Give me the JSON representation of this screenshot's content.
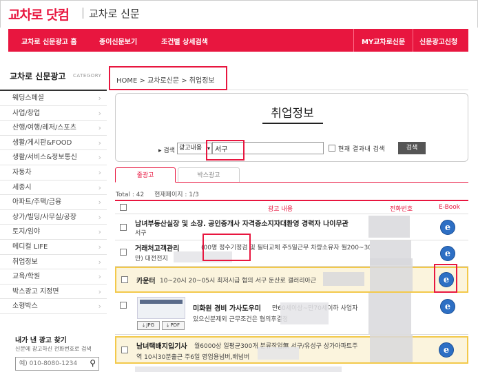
{
  "header": {
    "logo": "교차로 닷컴",
    "sub": "교차로 신문"
  },
  "nav": {
    "home": "교차로 신문광고 홈",
    "paper": "종이신문보기",
    "detail": "조건별 상세검색",
    "my": "MY교차로신문",
    "apply": "신문광고신청"
  },
  "sidebar": {
    "heading": "교차로 신문광고",
    "category": "CATEGORY",
    "items": [
      "웨딩스페셜",
      "사업/창업",
      "산행/여행/레저/스포츠",
      "생활/게시판&FOOD",
      "생활/서비스&정보통신",
      "자동차",
      "세종시",
      "아파트/주택/금융",
      "상가/빌딩/사무실/공장",
      "토지/임야",
      "메디컬 LIFE",
      "취업정보",
      "교육/학원",
      "박스광고 지정면",
      "소형박스"
    ]
  },
  "find": {
    "title": "내가 낸 광고 찾기",
    "desc": "신문에 광고하신 전화번호로 검색",
    "placeholder": "예) 010-8080-1234"
  },
  "breadcrumb": "HOME > 교차로신문 > 취업정보",
  "page_title": "취업정보",
  "search": {
    "label": "▸ 검색",
    "select_value": "광고내용",
    "input_value": "서구",
    "within_label": "현재 결과내 검색",
    "button": "검색"
  },
  "tabs": {
    "active": "줄광고",
    "inactive": "박스광고"
  },
  "totals": {
    "total": "Total : 42",
    "page": "현재페이지 : 1/3"
  },
  "table": {
    "col_content": "광고 내용",
    "col_phone": "전화번호",
    "col_ebook": "E-Book",
    "rows": [
      {
        "title": "남녀부동산실장 및 소장. 공인중개사 자격증소지자대환영 경력자 나이무관",
        "body": "서구"
      },
      {
        "title": "거래처고객관리",
        "body": "(00명 정수기정검 및 필터교체 주5일근무 차량소유자 월200~300",
        "body2": "만) 대전전지"
      },
      {
        "title": "카운터",
        "body": "10~20시 20~05시 최저시급 협의 서구 둔산로 갤러리아근"
      },
      {
        "title": "미화원 경비 가사도우미",
        "body": "만60세이상~만70세이하 사업자",
        "body2": "있으신분제외 근무조건은 협의후결정"
      },
      {
        "title": "남녀택배지입기사",
        "body": "월6000상 일평균300개 분류작업無 서구/유성구 상가아파트주",
        "body2": "역 10시30분출근 주6일 영업용넘버,배넘버"
      },
      {
        "title": "",
        "body": ""
      }
    ],
    "thumb_jpg": "JPG",
    "thumb_pdf": "PDF",
    "ebook_glyph": "e"
  }
}
